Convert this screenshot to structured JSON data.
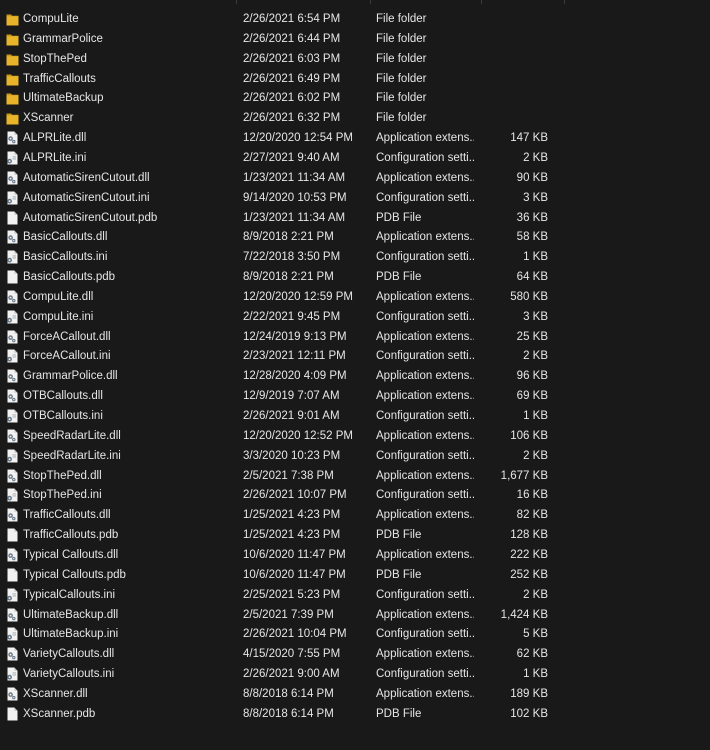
{
  "files": [
    {
      "name": "CompuLite",
      "date": "2/26/2021 6:54 PM",
      "type": "File folder",
      "size": "",
      "icon": "folder-icon"
    },
    {
      "name": "GrammarPolice",
      "date": "2/26/2021 6:44 PM",
      "type": "File folder",
      "size": "",
      "icon": "folder-icon"
    },
    {
      "name": "StopThePed",
      "date": "2/26/2021 6:03 PM",
      "type": "File folder",
      "size": "",
      "icon": "folder-icon"
    },
    {
      "name": "TrafficCallouts",
      "date": "2/26/2021 6:49 PM",
      "type": "File folder",
      "size": "",
      "icon": "folder-icon"
    },
    {
      "name": "UltimateBackup",
      "date": "2/26/2021 6:02 PM",
      "type": "File folder",
      "size": "",
      "icon": "folder-icon"
    },
    {
      "name": "XScanner",
      "date": "2/26/2021 6:32 PM",
      "type": "File folder",
      "size": "",
      "icon": "folder-icon"
    },
    {
      "name": "ALPRLite.dll",
      "date": "12/20/2020 12:54 PM",
      "type": "Application extens...",
      "size": "147 KB",
      "icon": "dll-file-icon"
    },
    {
      "name": "ALPRLite.ini",
      "date": "2/27/2021 9:40 AM",
      "type": "Configuration setti...",
      "size": "2 KB",
      "icon": "ini-file-icon"
    },
    {
      "name": "AutomaticSirenCutout.dll",
      "date": "1/23/2021 11:34 AM",
      "type": "Application extens...",
      "size": "90 KB",
      "icon": "dll-file-icon"
    },
    {
      "name": "AutomaticSirenCutout.ini",
      "date": "9/14/2020 10:53 PM",
      "type": "Configuration setti...",
      "size": "3 KB",
      "icon": "ini-file-icon"
    },
    {
      "name": "AutomaticSirenCutout.pdb",
      "date": "1/23/2021 11:34 AM",
      "type": "PDB File",
      "size": "36 KB",
      "icon": "blank-file-icon"
    },
    {
      "name": "BasicCallouts.dll",
      "date": "8/9/2018 2:21 PM",
      "type": "Application extens...",
      "size": "58 KB",
      "icon": "dll-file-icon"
    },
    {
      "name": "BasicCallouts.ini",
      "date": "7/22/2018 3:50 PM",
      "type": "Configuration setti...",
      "size": "1 KB",
      "icon": "ini-file-icon"
    },
    {
      "name": "BasicCallouts.pdb",
      "date": "8/9/2018 2:21 PM",
      "type": "PDB File",
      "size": "64 KB",
      "icon": "blank-file-icon"
    },
    {
      "name": "CompuLite.dll",
      "date": "12/20/2020 12:59 PM",
      "type": "Application extens...",
      "size": "580 KB",
      "icon": "dll-file-icon"
    },
    {
      "name": "CompuLite.ini",
      "date": "2/22/2021 9:45 PM",
      "type": "Configuration setti...",
      "size": "3 KB",
      "icon": "ini-file-icon"
    },
    {
      "name": "ForceACallout.dll",
      "date": "12/24/2019 9:13 PM",
      "type": "Application extens...",
      "size": "25 KB",
      "icon": "dll-file-icon"
    },
    {
      "name": "ForceACallout.ini",
      "date": "2/23/2021 12:11 PM",
      "type": "Configuration setti...",
      "size": "2 KB",
      "icon": "ini-file-icon"
    },
    {
      "name": "GrammarPolice.dll",
      "date": "12/28/2020 4:09 PM",
      "type": "Application extens...",
      "size": "96 KB",
      "icon": "dll-file-icon"
    },
    {
      "name": "OTBCallouts.dll",
      "date": "12/9/2019 7:07 AM",
      "type": "Application extens...",
      "size": "69 KB",
      "icon": "dll-file-icon"
    },
    {
      "name": "OTBCallouts.ini",
      "date": "2/26/2021 9:01 AM",
      "type": "Configuration setti...",
      "size": "1 KB",
      "icon": "ini-file-icon"
    },
    {
      "name": "SpeedRadarLite.dll",
      "date": "12/20/2020 12:52 PM",
      "type": "Application extens...",
      "size": "106 KB",
      "icon": "dll-file-icon"
    },
    {
      "name": "SpeedRadarLite.ini",
      "date": "3/3/2020 10:23 PM",
      "type": "Configuration setti...",
      "size": "2 KB",
      "icon": "ini-file-icon"
    },
    {
      "name": "StopThePed.dll",
      "date": "2/5/2021 7:38 PM",
      "type": "Application extens...",
      "size": "1,677 KB",
      "icon": "dll-file-icon"
    },
    {
      "name": "StopThePed.ini",
      "date": "2/26/2021 10:07 PM",
      "type": "Configuration setti...",
      "size": "16 KB",
      "icon": "ini-file-icon"
    },
    {
      "name": "TrafficCallouts.dll",
      "date": "1/25/2021 4:23 PM",
      "type": "Application extens...",
      "size": "82 KB",
      "icon": "dll-file-icon"
    },
    {
      "name": "TrafficCallouts.pdb",
      "date": "1/25/2021 4:23 PM",
      "type": "PDB File",
      "size": "128 KB",
      "icon": "blank-file-icon"
    },
    {
      "name": "Typical Callouts.dll",
      "date": "10/6/2020 11:47 PM",
      "type": "Application extens...",
      "size": "222 KB",
      "icon": "dll-file-icon"
    },
    {
      "name": "Typical Callouts.pdb",
      "date": "10/6/2020 11:47 PM",
      "type": "PDB File",
      "size": "252 KB",
      "icon": "blank-file-icon"
    },
    {
      "name": "TypicalCallouts.ini",
      "date": "2/25/2021 5:23 PM",
      "type": "Configuration setti...",
      "size": "2 KB",
      "icon": "ini-file-icon"
    },
    {
      "name": "UltimateBackup.dll",
      "date": "2/5/2021 7:39 PM",
      "type": "Application extens...",
      "size": "1,424 KB",
      "icon": "dll-file-icon"
    },
    {
      "name": "UltimateBackup.ini",
      "date": "2/26/2021 10:04 PM",
      "type": "Configuration setti...",
      "size": "5 KB",
      "icon": "ini-file-icon"
    },
    {
      "name": "VarietyCallouts.dll",
      "date": "4/15/2020 7:55 PM",
      "type": "Application extens...",
      "size": "62 KB",
      "icon": "dll-file-icon"
    },
    {
      "name": "VarietyCallouts.ini",
      "date": "2/26/2021 9:00 AM",
      "type": "Configuration setti...",
      "size": "1 KB",
      "icon": "ini-file-icon"
    },
    {
      "name": "XScanner.dll",
      "date": "8/8/2018 6:14 PM",
      "type": "Application extens...",
      "size": "189 KB",
      "icon": "dll-file-icon"
    },
    {
      "name": "XScanner.pdb",
      "date": "8/8/2018 6:14 PM",
      "type": "PDB File",
      "size": "102 KB",
      "icon": "blank-file-icon"
    }
  ],
  "colors": {
    "background": "#191919",
    "text": "#e6e6e6",
    "folder": "#e8b52a",
    "folder_dark": "#c9951a",
    "file_page": "#f2f2f2",
    "file_gear": "#6c7c8c"
  }
}
